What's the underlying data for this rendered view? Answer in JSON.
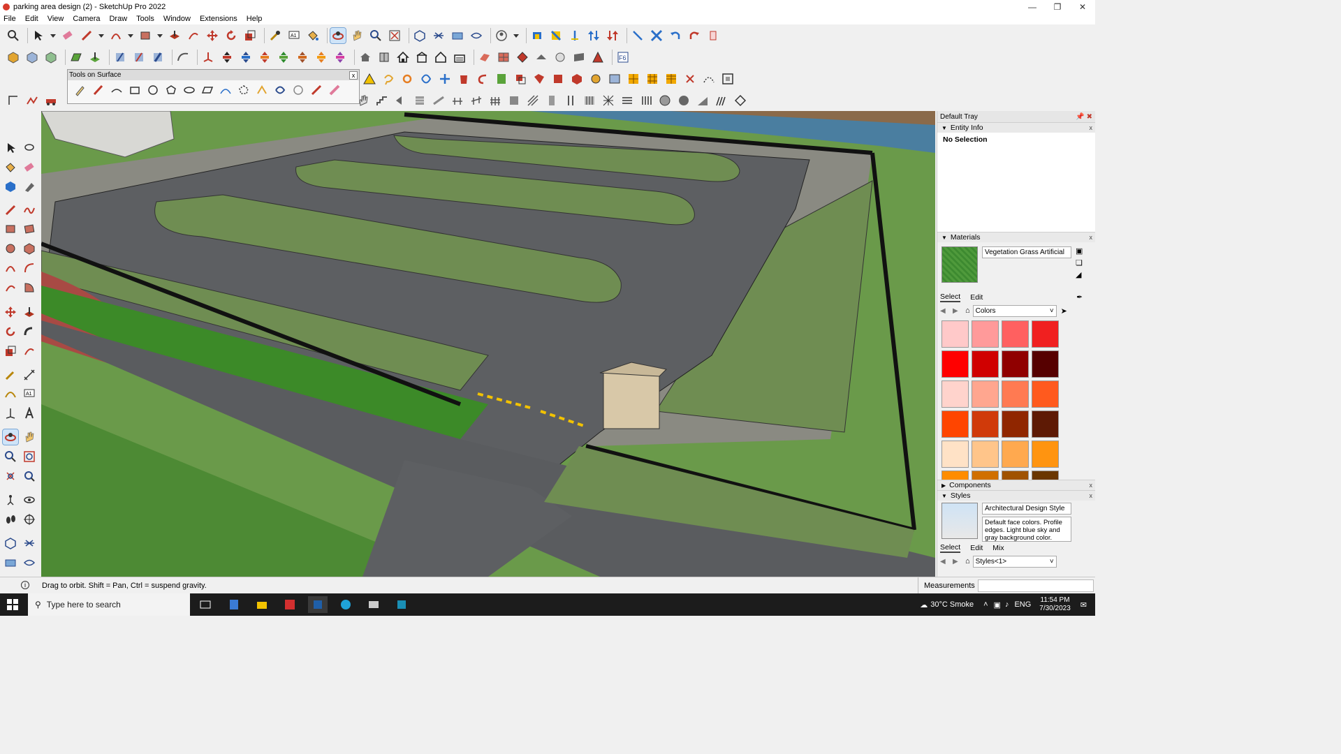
{
  "window": {
    "title": "parking area design (2) - SketchUp Pro 2022"
  },
  "menu": [
    "File",
    "Edit",
    "View",
    "Camera",
    "Draw",
    "Tools",
    "Window",
    "Extensions",
    "Help"
  ],
  "floating_palette": {
    "title": "Tools on Surface"
  },
  "tray": {
    "title": "Default Tray",
    "entity_info": {
      "header": "Entity Info",
      "selection": "No Selection"
    },
    "materials": {
      "header": "Materials",
      "name": "Vegetation Grass Artificial",
      "tabs": [
        "Select",
        "Edit"
      ],
      "library": "Colors",
      "colors": [
        "#ffc9c9",
        "#ff9a9a",
        "#ff6060",
        "#f02020",
        "#ff0000",
        "#d00000",
        "#900000",
        "#560000",
        "#ffd3cc",
        "#ffa68f",
        "#ff7a52",
        "#ff5a1e",
        "#ff4500",
        "#d03a0a",
        "#902600",
        "#5e1a05",
        "#ffe2c6",
        "#ffc58a",
        "#ffa94f",
        "#ff9410",
        "#ff8c00",
        "#d06f00",
        "#a05200",
        "#6a3600"
      ]
    },
    "components": {
      "header": "Components"
    },
    "styles": {
      "header": "Styles",
      "name": "Architectural Design Style",
      "description": "Default face colors. Profile edges. Light blue sky and gray background color.",
      "tabs": [
        "Select",
        "Edit",
        "Mix"
      ],
      "library": "Styles<1>"
    }
  },
  "status": {
    "message": "Drag to orbit. Shift = Pan, Ctrl = suspend gravity.",
    "measurements_label": "Measurements"
  },
  "taskbar": {
    "search_placeholder": "Type here to search",
    "weather": "30°C Smoke",
    "lang": "ENG",
    "time": "11:54 PM",
    "date": "7/30/2023"
  }
}
